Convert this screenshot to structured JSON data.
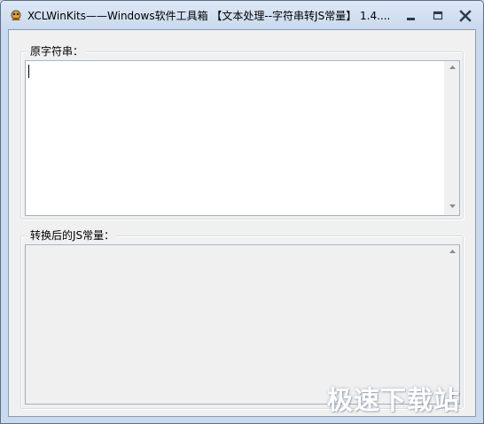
{
  "window": {
    "title": "XCLWinKits——Windows软件工具箱 【文本处理--字符串转JS常量】 1.4....",
    "icon": "app-icon"
  },
  "source_group": {
    "label": "原字符串：",
    "value": ""
  },
  "output_group": {
    "label": "转换后的JS常量：",
    "value": ""
  },
  "watermark": {
    "text": "极速下载站"
  },
  "colors": {
    "frame": "#c9d9ee",
    "client": "#f0f0f0",
    "textbox_border": "#abadb3"
  }
}
